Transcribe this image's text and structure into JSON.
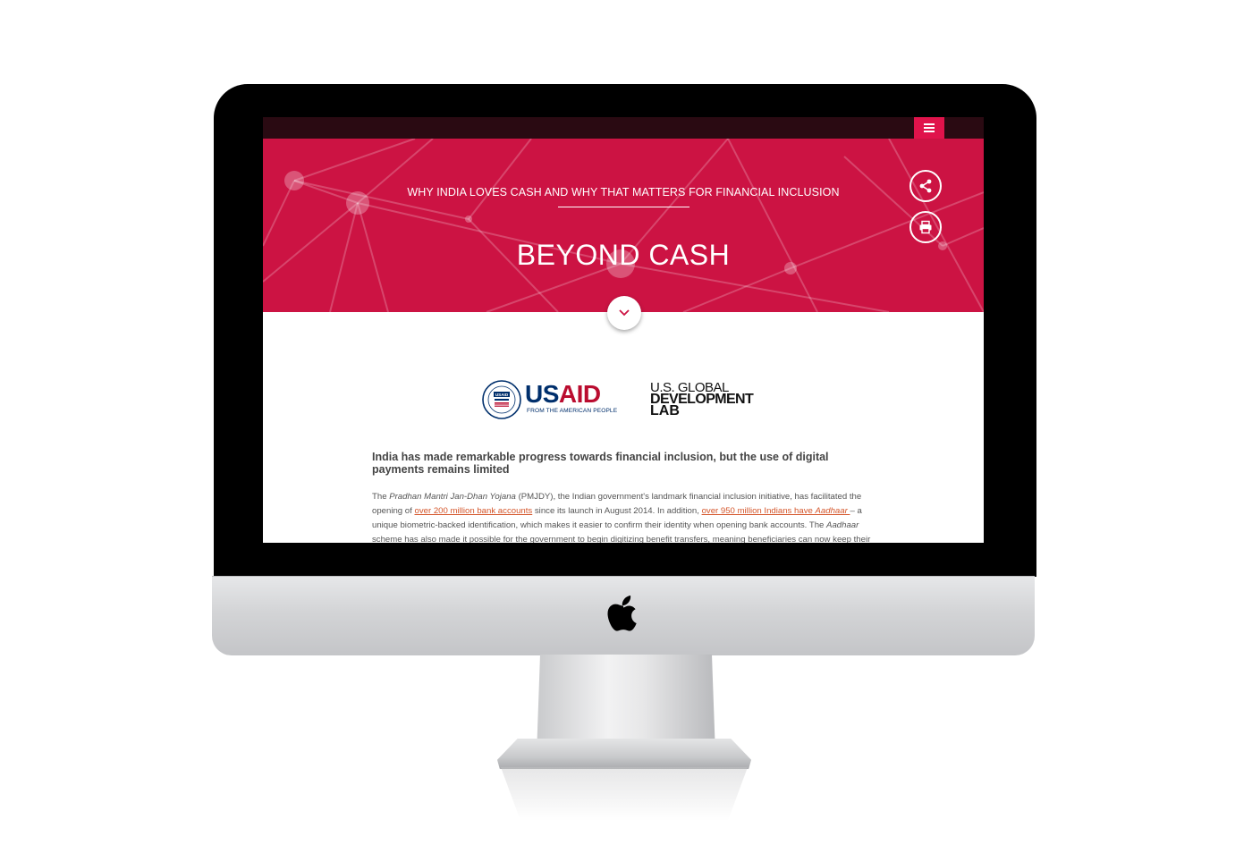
{
  "header": {
    "menu_icon": "hamburger-menu-icon",
    "subtitle": "WHY INDIA LOVES CASH AND WHY THAT MATTERS FOR FINANCIAL INCLUSION",
    "title": "BEYOND CASH",
    "share_icon": "share-icon",
    "print_icon": "print-icon",
    "scroll_icon": "chevron-down-icon"
  },
  "logos": {
    "usaid": {
      "word_blue": "US",
      "word_red": "AID",
      "tagline": "FROM THE AMERICAN PEOPLE",
      "seal_text": "USAID"
    },
    "gdl": {
      "line1": "U.S. GLOBAL",
      "line2": "DEVELOPMENT",
      "line3": "LAB"
    }
  },
  "article": {
    "lead": "India has made remarkable progress towards financial inclusion, but the use of digital payments remains limited",
    "p1": {
      "t1": "The ",
      "t2_italic": "Pradhan Mantri Jan-Dhan Yojana",
      "t3": " (PMJDY), the Indian government's landmark financial inclusion initiative, has facilitated the opening of ",
      "link1": "over 200 million bank accounts",
      "t4": " since its launch in August 2014. In addition, ",
      "link2_a": "over 950 million Indians have ",
      "link2_b_italic": "Aadhaar ",
      "t5": " – a unique biometric-backed identification, which makes it easier to confirm their identity when opening bank accounts. The ",
      "t6_italic": "Aadhaar",
      "t7": " scheme has also made it possible for the government to begin digitizing benefit transfers, meaning beneficiaries can now keep their"
    }
  },
  "colors": {
    "hero_red": "#cc1343",
    "menu_pink": "#e0134b",
    "link_orange": "#d4552a",
    "topbar_dark": "#2a0a12"
  },
  "device": {
    "brand_icon": "apple-logo-icon"
  }
}
